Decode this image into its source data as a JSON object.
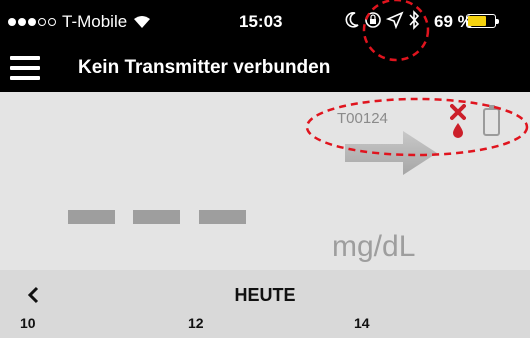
{
  "status_bar": {
    "carrier": "T-Mobile",
    "time": "15:03",
    "battery_percent": "69 %",
    "signal_bars_filled": 3,
    "signal_bars_total": 5
  },
  "nav": {
    "title": "Kein Transmitter verbunden"
  },
  "transmitter": {
    "id": "T00124"
  },
  "glucose": {
    "unit": "mg/dL"
  },
  "date_bar": {
    "label": "HEUTE",
    "ticks": [
      "10",
      "12",
      "14"
    ]
  },
  "colors": {
    "status_bar_bg": "#000000",
    "main_bg": "#e4e4e4",
    "date_bar_bg": "#d9d9d9",
    "error_red": "#cc1f2a",
    "annotation_red": "#e0141e",
    "battery_yellow": "#f5d20f"
  },
  "icons": [
    "wifi-icon",
    "moon-icon",
    "lock-rotation-icon",
    "location-icon",
    "bluetooth-icon",
    "battery-icon",
    "hamburger-icon",
    "error-x-icon",
    "blood-drop-icon",
    "sensor-battery-icon",
    "trend-arrow-icon",
    "back-chevron-icon"
  ]
}
